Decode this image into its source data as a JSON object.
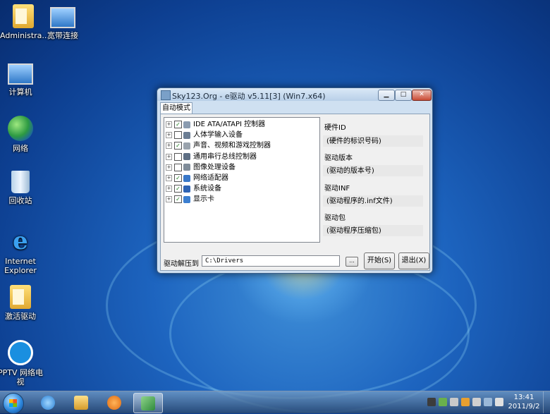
{
  "desktop": {
    "icons": [
      {
        "label": "Administra...",
        "icon": "user-folder-icon"
      },
      {
        "label": "宽带连接",
        "icon": "broadband-connection-icon"
      },
      {
        "label": "计算机",
        "icon": "computer-icon"
      },
      {
        "label": "网络",
        "icon": "network-icon"
      },
      {
        "label": "回收站",
        "icon": "recycle-bin-icon"
      },
      {
        "label": "Internet Explorer",
        "icon": "internet-explorer-icon"
      },
      {
        "label": "激活驱动",
        "icon": "folder-icon"
      },
      {
        "label": "PPTV 网络电视",
        "icon": "pptv-icon"
      }
    ]
  },
  "window": {
    "title": "Sky123.Org - e驱动 v5.11[3] (Win7.x64)",
    "controls": {
      "minimize": "▁",
      "maximize": "□",
      "close": "✕"
    },
    "tab": "自动模式",
    "tree": [
      {
        "label": "IDE ATA/ATAPI 控制器",
        "checked": true,
        "icon_color": "#8a9bb0"
      },
      {
        "label": "人体学输入设备",
        "checked": false,
        "icon_color": "#6b7d93"
      },
      {
        "label": "声音、视频和游戏控制器",
        "checked": true,
        "icon_color": "#9aa3ad"
      },
      {
        "label": "通用串行总线控制器",
        "checked": false,
        "icon_color": "#5e6f84"
      },
      {
        "label": "图像处理设备",
        "checked": false,
        "icon_color": "#7f8c99"
      },
      {
        "label": "网络适配器",
        "checked": true,
        "icon_color": "#3a78c8"
      },
      {
        "label": "系统设备",
        "checked": true,
        "icon_color": "#2f64b4"
      },
      {
        "label": "显示卡",
        "checked": true,
        "icon_color": "#3c7fd0"
      }
    ],
    "info": {
      "hardware_id_label": "硬件ID",
      "hardware_id_value": "(硬件的标识号码)",
      "driver_version_label": "驱动版本",
      "driver_version_value": "(驱动的版本号)",
      "driver_inf_label": "驱动INF",
      "driver_inf_value": "(驱动程序的.inf文件)",
      "driver_pack_label": "驱动包",
      "driver_pack_value": "(驱动程序压缩包)"
    },
    "extract_label": "驱动解压到",
    "extract_path": "C:\\Drivers",
    "browse_label": "...",
    "start_button": "开始(S)",
    "exit_button": "退出(X)"
  },
  "taskbar": {
    "clock_time": "13:41",
    "clock_date": "2011/9/2",
    "pinned": [
      "internet-explorer-icon",
      "explorer-icon",
      "media-player-icon",
      "e-driver-icon"
    ]
  }
}
